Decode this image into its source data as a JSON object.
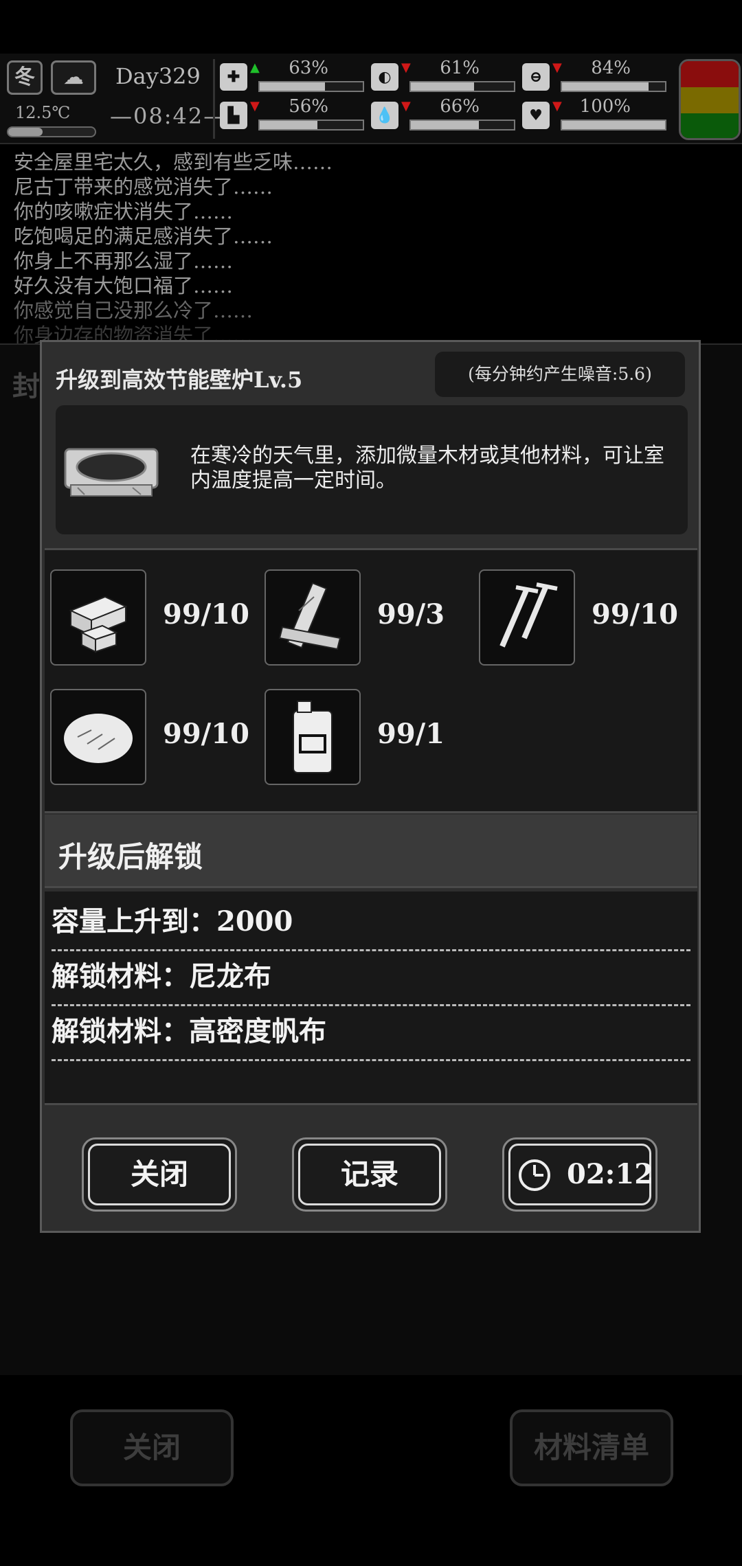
{
  "status": {
    "season": "冬",
    "temperature": "12.5℃",
    "day": "Day329",
    "time": "—08:42—",
    "stats": [
      {
        "icon": "medkit-icon",
        "pct": "63%",
        "level": 0.63,
        "arrow": "up"
      },
      {
        "icon": "stomach-icon",
        "pct": "61%",
        "level": 0.61,
        "arrow": "down"
      },
      {
        "icon": "pill-icon",
        "pct": "84%",
        "level": 0.84,
        "arrow": "down"
      },
      {
        "icon": "boot-icon",
        "pct": "56%",
        "level": 0.56,
        "arrow": "down"
      },
      {
        "icon": "water-drop-icon",
        "pct": "66%",
        "level": 0.66,
        "arrow": "down"
      },
      {
        "icon": "heart-icon",
        "pct": "100%",
        "level": 1.0,
        "arrow": "down"
      }
    ]
  },
  "log": [
    "安全屋里宅太久，感到有些乏味……",
    "尼古丁带来的感觉消失了……",
    "你的咳嗽症状消失了……",
    "吃饱喝足的满足感消失了……",
    "你身上不再那么湿了……",
    "好久没有大饱口福了……",
    "你感觉自己没那么冷了……",
    "你身边存的物资消失了……"
  ],
  "background": {
    "title": "封",
    "close_label": "关闭",
    "materials_label": "材料清单"
  },
  "dialog": {
    "title": "升级到高效节能壁炉Lv.5",
    "noise": "(每分钟约产生噪音:5.6)",
    "description": "在寒冷的天气里，添加微量木材或其他材料，可让室内温度提高一定时间。",
    "materials": [
      {
        "icon": "wood-blocks-icon",
        "count": "99/10"
      },
      {
        "icon": "planks-icon",
        "count": "99/3"
      },
      {
        "icon": "screws-icon",
        "count": "99/10"
      },
      {
        "icon": "fiber-icon",
        "count": "99/10"
      },
      {
        "icon": "jerrycan-icon",
        "count": "99/1"
      }
    ],
    "unlock_header": "升级后解锁",
    "unlocks": [
      "容量上升到：2000",
      "解锁材料：尼龙布",
      "解锁材料：高密度帆布"
    ],
    "buttons": {
      "close": "关闭",
      "record": "记录",
      "timer": "02:12"
    }
  }
}
